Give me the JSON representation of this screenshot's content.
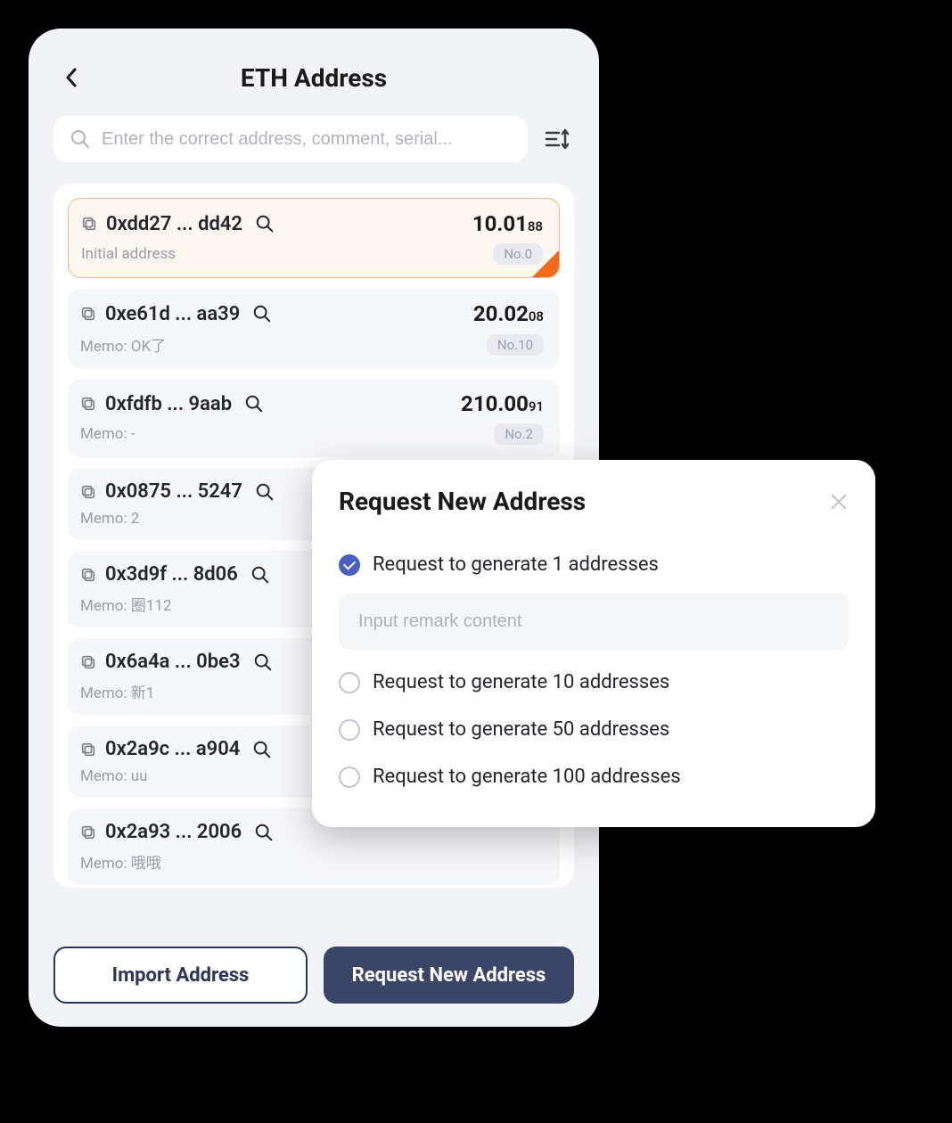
{
  "header": {
    "title": "ETH Address"
  },
  "search": {
    "placeholder": "Enter the correct address, comment, serial..."
  },
  "addresses": [
    {
      "addr": "0xdd27 ... dd42",
      "balance_int": "10.01",
      "balance_dec": "88",
      "memo": "Initial address",
      "no": "No.0",
      "selected": true
    },
    {
      "addr": "0xe61d ... aa39",
      "balance_int": "20.02",
      "balance_dec": "08",
      "memo": "Memo: OK了",
      "no": "No.10",
      "selected": false
    },
    {
      "addr": "0xfdfb ... 9aab",
      "balance_int": "210.00",
      "balance_dec": "91",
      "memo": "Memo: -",
      "no": "No.2",
      "selected": false
    },
    {
      "addr": "0x0875 ... 5247",
      "balance_int": "",
      "balance_dec": "",
      "memo": "Memo: 2",
      "no": "",
      "selected": false
    },
    {
      "addr": "0x3d9f ... 8d06",
      "balance_int": "",
      "balance_dec": "",
      "memo": "Memo: 圈112",
      "no": "",
      "selected": false
    },
    {
      "addr": "0x6a4a ... 0be3",
      "balance_int": "",
      "balance_dec": "",
      "memo": "Memo: 新1",
      "no": "",
      "selected": false
    },
    {
      "addr": "0x2a9c ... a904",
      "balance_int": "",
      "balance_dec": "",
      "memo": "Memo: uu",
      "no": "",
      "selected": false
    },
    {
      "addr": "0x2a93 ... 2006",
      "balance_int": "",
      "balance_dec": "",
      "memo": "Memo: 哦哦",
      "no": "",
      "selected": false
    }
  ],
  "buttons": {
    "import": "Import Address",
    "request": "Request New Address"
  },
  "modal": {
    "title": "Request New Address",
    "remark_placeholder": "Input remark content",
    "options": [
      {
        "label": "Request to generate 1 addresses",
        "checked": true
      },
      {
        "label": "Request to generate 10 addresses",
        "checked": false
      },
      {
        "label": "Request to generate 50 addresses",
        "checked": false
      },
      {
        "label": "Request to generate 100 addresses",
        "checked": false
      }
    ]
  }
}
